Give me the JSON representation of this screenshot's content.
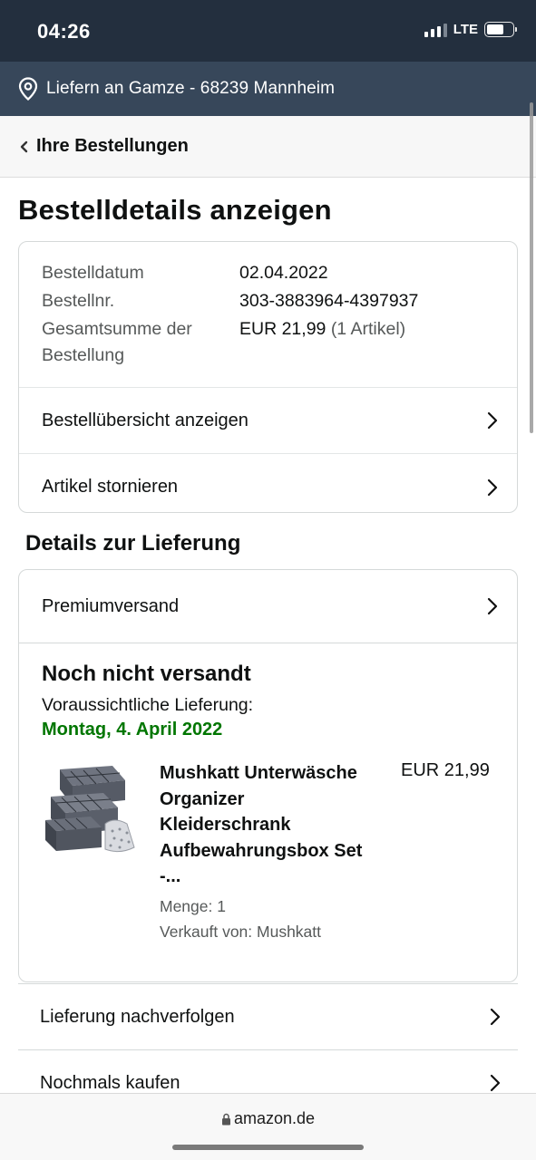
{
  "status_bar": {
    "time": "04:26",
    "network": "LTE",
    "battery_level": 0.68
  },
  "delivery_bar": {
    "text": "Liefern an Gamze - 68239 Mannheim",
    "icon": "location-pin-icon"
  },
  "nav": {
    "back_label": "Ihre Bestellungen"
  },
  "page": {
    "title": "Bestelldetails anzeigen"
  },
  "order_info": {
    "date_label": "Bestelldatum",
    "date_value": "02.04.2022",
    "number_label": "Bestellnr.",
    "number_value": "303-3883964-4397937",
    "total_label": "Gesamtsumme der Bestellung",
    "total_value": "EUR 21,99",
    "total_items": "(1 Artikel)"
  },
  "order_actions": {
    "overview": "Bestellübersicht anzeigen",
    "cancel": "Artikel stornieren"
  },
  "delivery": {
    "section_title": "Details zur Lieferung",
    "shipping_method": "Premiumversand",
    "status": "Noch nicht versandt",
    "expected_label": "Voraussichtliche Lieferung:",
    "expected_date": "Montag, 4. April 2022",
    "expected_date_color": "#007600",
    "item": {
      "title": "Mushkatt Unterwäsche Organizer Kleiderschrank Aufbewahrungsbox Set -...",
      "price": "EUR 21,99",
      "quantity": "Menge: 1",
      "seller": "Verkauft von: Mushkatt"
    }
  },
  "more_actions": {
    "track": "Lieferung nachverfolgen",
    "buy_again": "Nochmals kaufen"
  },
  "browser": {
    "url": "amazon.de"
  },
  "colors": {
    "status_bg": "#232f3e",
    "deliver_bg": "#37475a",
    "green": "#007600"
  }
}
